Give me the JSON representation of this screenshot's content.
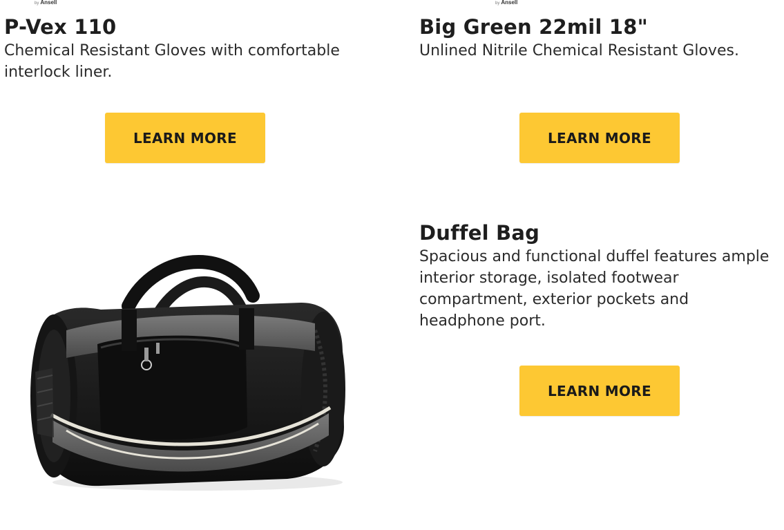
{
  "logos": {
    "left": {
      "by": "by",
      "brand": "Ansell"
    },
    "right": {
      "by": "by",
      "brand": "Ansell"
    }
  },
  "products": [
    {
      "title": "P-Vex 110",
      "description": "Chemical Resistant Gloves with comfortable interlock liner.",
      "button_label": "LEARN MORE"
    },
    {
      "title": "Big Green 22mil 18\"",
      "description": "Unlined Nitrile Chemical Resistant Gloves.",
      "button_label": "LEARN MORE"
    },
    {
      "title": "Duffel Bag",
      "description": "Spacious and functional duffel features ample interior storage, isolated footwear compartment, exterior pockets and headphone port.",
      "button_label": "LEARN MORE"
    }
  ],
  "colors": {
    "button_bg": "#fdc833",
    "title_text": "#1e1e1e"
  },
  "images": {
    "bag": "duffel-bag-image"
  }
}
